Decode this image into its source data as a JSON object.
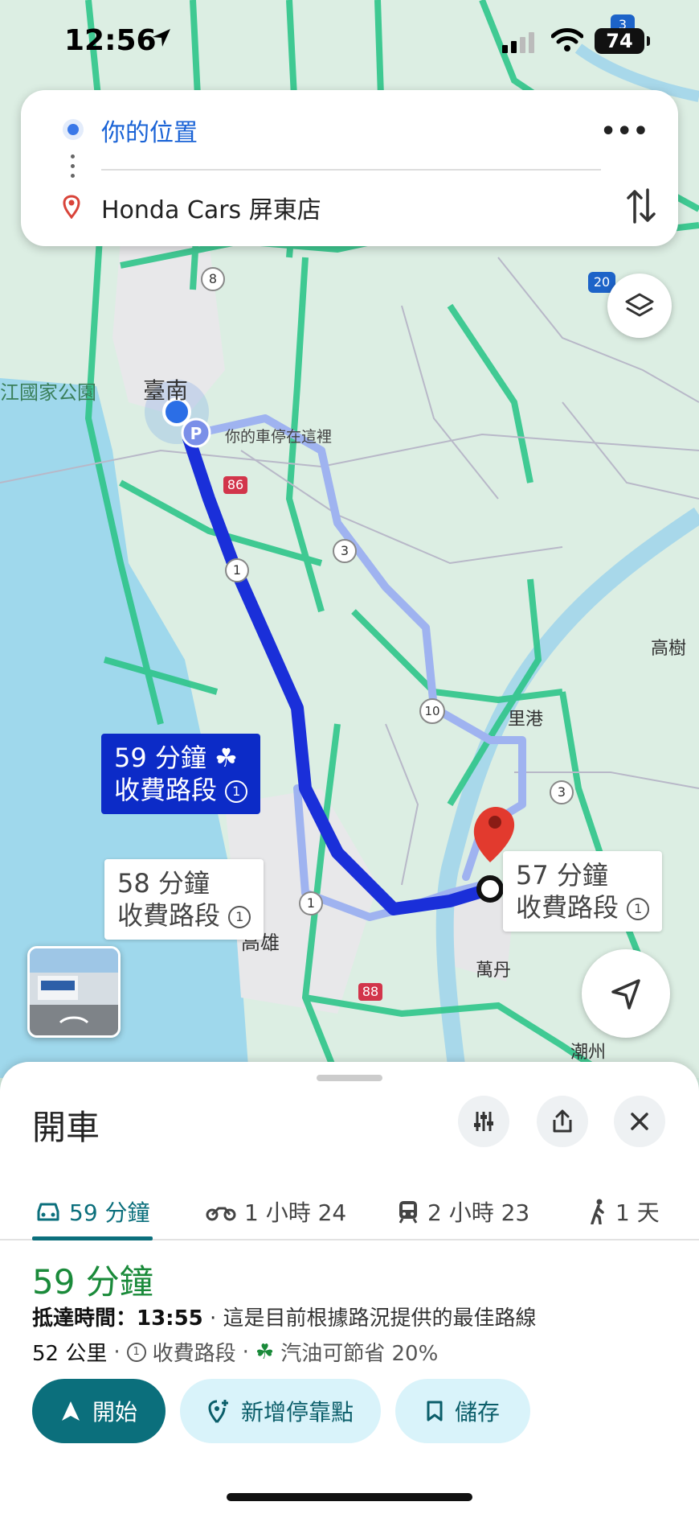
{
  "status_bar": {
    "time": "12:56",
    "battery": "74"
  },
  "directions": {
    "origin": "你的位置",
    "destination": "Honda Cars 屏東店"
  },
  "map": {
    "labels": {
      "tainan": "臺南",
      "park": "江國家公園",
      "parked": "你的車停在這裡",
      "kaohsiung": "高雄",
      "ligang": "里港",
      "gaoshu": "高樹",
      "wandan": "萬丹",
      "chaozhou": "潮州"
    },
    "road_shields": [
      "8",
      "86",
      "1",
      "3",
      "10",
      "3",
      "1",
      "88",
      "20",
      "3"
    ],
    "callouts": {
      "primary": {
        "time": "59 分鐘",
        "toll": "收費路段"
      },
      "alt1": {
        "time": "58 分鐘",
        "toll": "收費路段"
      },
      "alt2": {
        "time": "57 分鐘",
        "toll": "收費路段"
      }
    }
  },
  "sheet": {
    "title": "開車",
    "tabs": [
      {
        "label": "59 分鐘",
        "icon": "car-icon"
      },
      {
        "label": "1 小時 24",
        "icon": "motorcycle-icon"
      },
      {
        "label": "2 小時 23",
        "icon": "transit-icon"
      },
      {
        "label": "1 天",
        "icon": "walk-icon"
      }
    ],
    "eta": "59 分鐘",
    "arrival_label": "抵達時間：13:55",
    "arrival_note": " · 這是目前根據路況提供的最佳路線",
    "distance": "52 公里",
    "toll": "收費路段",
    "fuel": "汽油可節省 20%",
    "actions": {
      "start": "開始",
      "add_stop": "新增停靠點",
      "save": "儲存"
    }
  },
  "colors": {
    "route": "#0c2bc7",
    "alt_route": "#9fb3f0",
    "accent": "#0b6f7c",
    "eta_green": "#1a8a3a"
  }
}
